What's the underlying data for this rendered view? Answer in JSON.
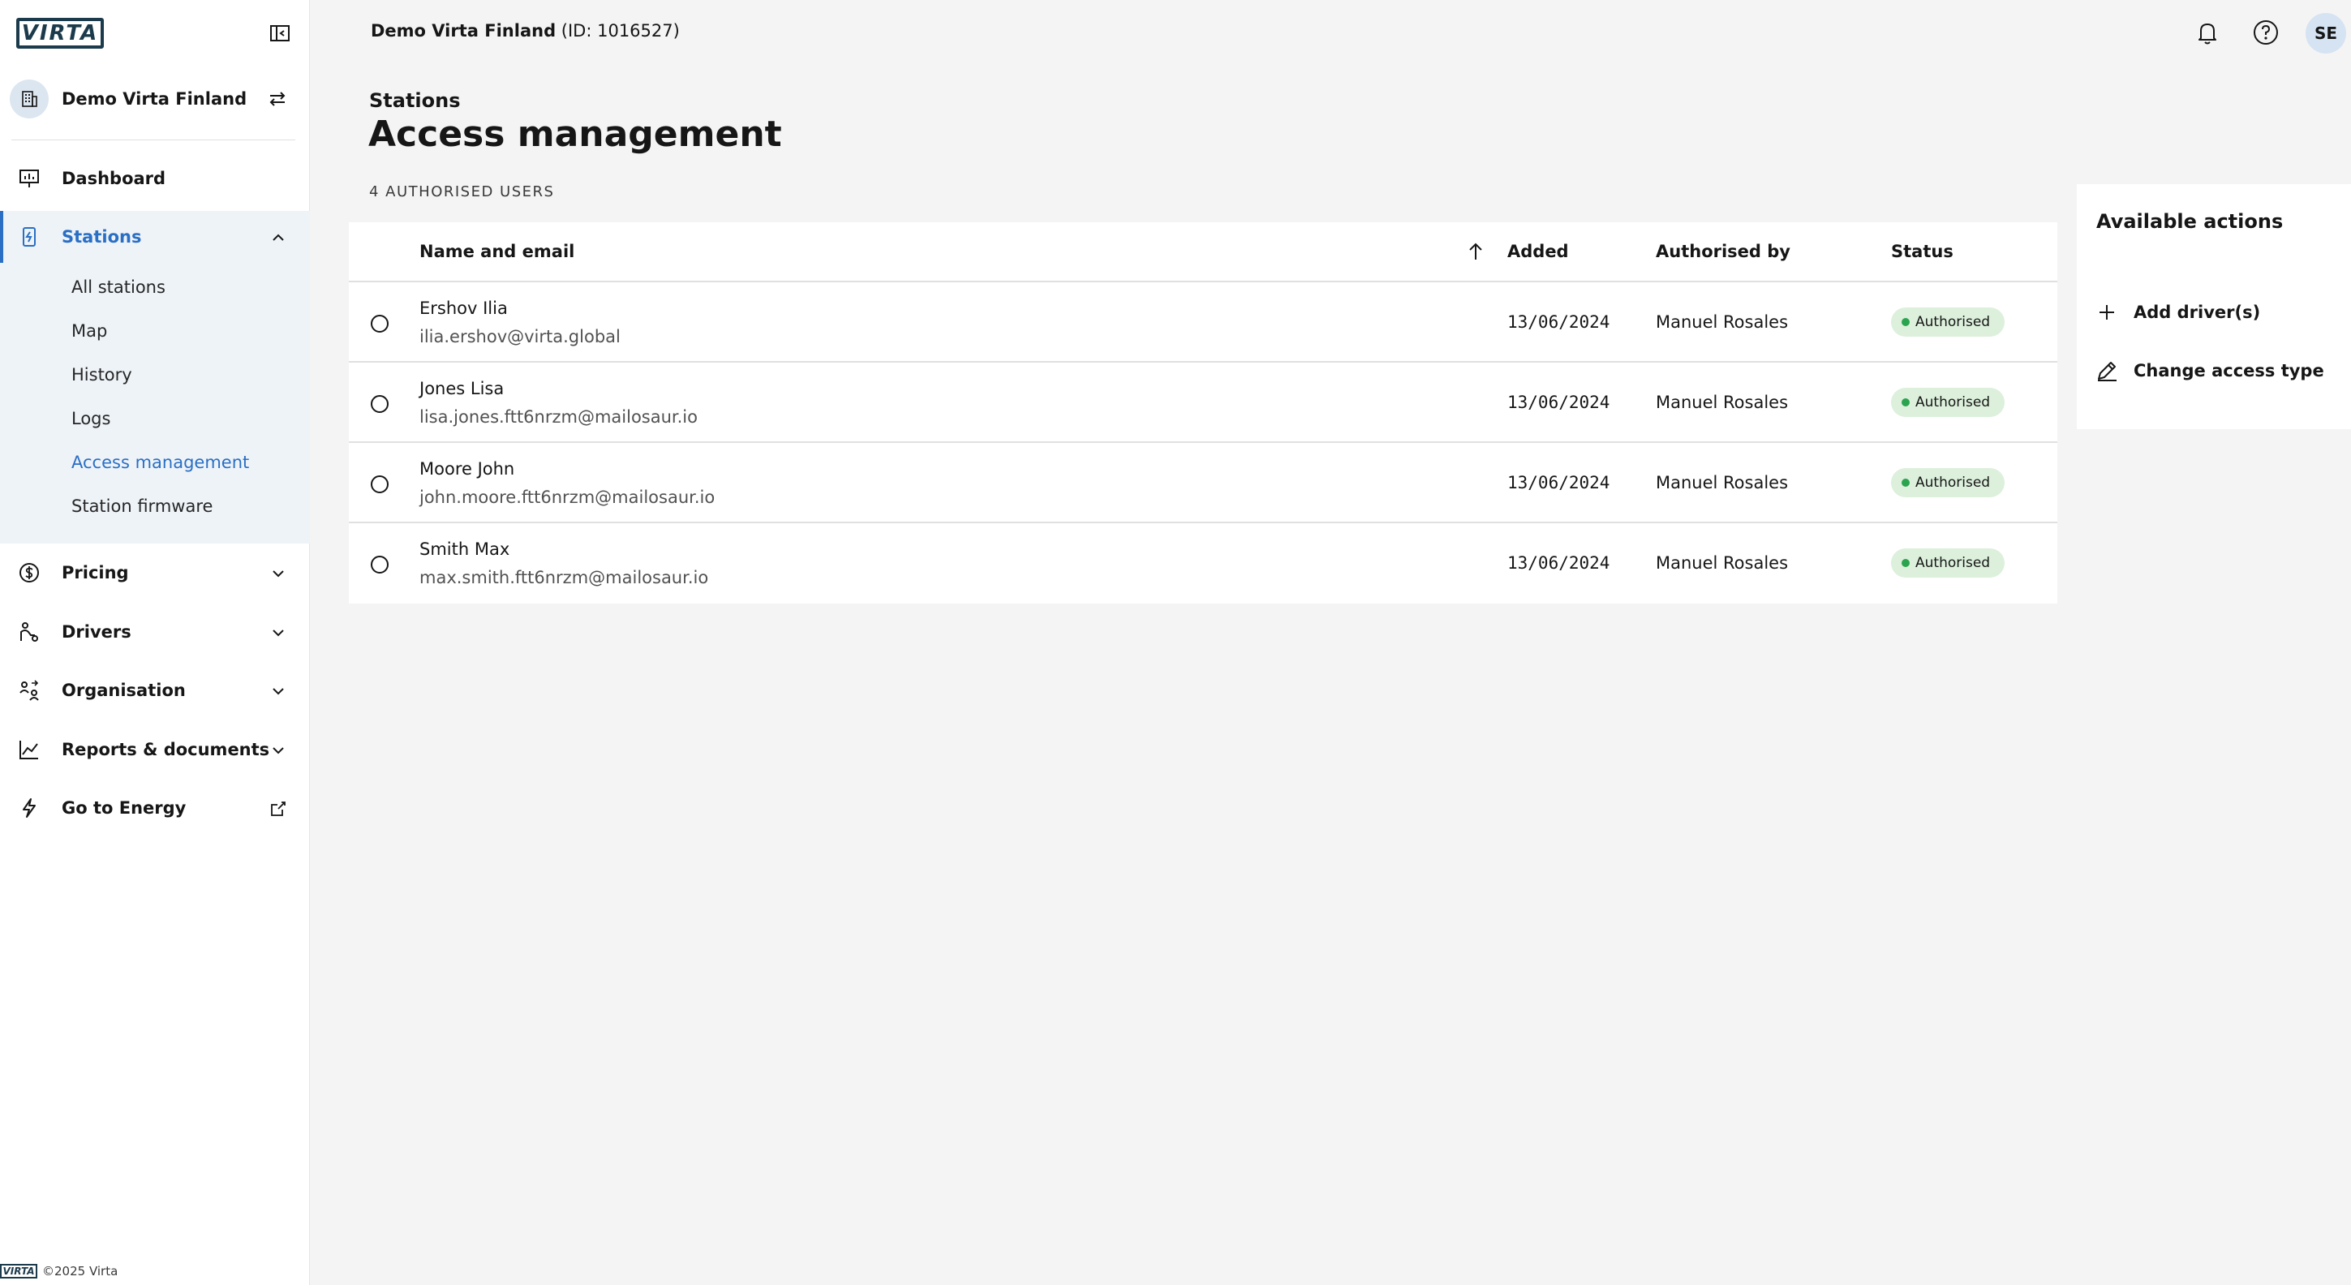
{
  "brand": {
    "logo_text": "VIRTA"
  },
  "header": {
    "org_name": "Demo Virta Finland",
    "org_id": "(ID: 1016527)",
    "user_initials": "SE"
  },
  "sidebar": {
    "org_name": "Demo Virta Finland",
    "items": [
      {
        "label": "Dashboard"
      },
      {
        "label": "Stations"
      },
      {
        "label": "Pricing"
      },
      {
        "label": "Drivers"
      },
      {
        "label": "Organisation"
      },
      {
        "label": "Reports & documents"
      },
      {
        "label": "Go to Energy"
      }
    ],
    "stations_sub": [
      {
        "label": "All stations"
      },
      {
        "label": "Map"
      },
      {
        "label": "History"
      },
      {
        "label": "Logs"
      },
      {
        "label": "Access management"
      },
      {
        "label": "Station firmware"
      }
    ],
    "footer": "©2025 Virta"
  },
  "page": {
    "breadcrumb": "Stations",
    "title": "Access management",
    "count_label": "4 AUTHORISED USERS"
  },
  "table": {
    "columns": [
      "Name and email",
      "Added",
      "Authorised by",
      "Status"
    ],
    "rows": [
      {
        "name": "Ershov Ilia",
        "email": "ilia.ershov@virta.global",
        "added": "13/06/2024",
        "by": "Manuel Rosales",
        "status": "Authorised"
      },
      {
        "name": "Jones Lisa",
        "email": "lisa.jones.ftt6nrzm@mailosaur.io",
        "added": "13/06/2024",
        "by": "Manuel Rosales",
        "status": "Authorised"
      },
      {
        "name": "Moore John",
        "email": "john.moore.ftt6nrzm@mailosaur.io",
        "added": "13/06/2024",
        "by": "Manuel Rosales",
        "status": "Authorised"
      },
      {
        "name": "Smith Max",
        "email": "max.smith.ftt6nrzm@mailosaur.io",
        "added": "13/06/2024",
        "by": "Manuel Rosales",
        "status": "Authorised"
      }
    ]
  },
  "actions": {
    "title": "Available actions",
    "add_label": "Add driver(s)",
    "change_label": "Change access type"
  },
  "colors": {
    "accent": "#2a6fc4",
    "status_green": "#2aa44f",
    "status_bg": "#dcf0dc"
  }
}
